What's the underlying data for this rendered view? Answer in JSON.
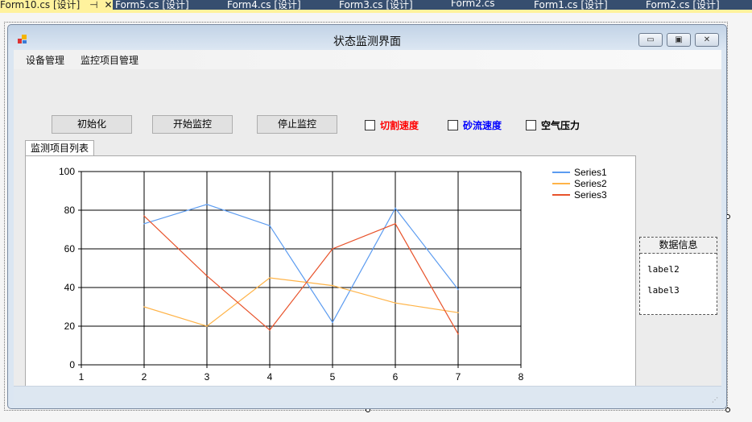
{
  "doc_tabs": [
    {
      "label": "Form10.cs [设计]",
      "active": true
    },
    {
      "label": "Form5.cs [设计]"
    },
    {
      "label": "Form4.cs [设计]"
    },
    {
      "label": "Form3.cs [设计]"
    },
    {
      "label": "Form2.cs"
    },
    {
      "label": "Form1.cs [设计]"
    },
    {
      "label": "Form2.cs [设计]"
    }
  ],
  "window": {
    "title": "状态监测界面"
  },
  "menu": [
    "设备管理",
    "监控项目管理"
  ],
  "buttons": {
    "init": "初始化",
    "start": "开始监控",
    "stop": "停止监控"
  },
  "checkboxes": [
    {
      "label": "切割速度",
      "color": "#ff0000",
      "checked": false
    },
    {
      "label": "砂流速度",
      "color": "#0000ff",
      "checked": false
    },
    {
      "label": "空气压力",
      "color": "#000000",
      "checked": false
    }
  ],
  "panel_tab": "监测项目列表",
  "group": {
    "title": "数据信息",
    "label2": "label2",
    "label3": "label3"
  },
  "chart_data": {
    "type": "line",
    "x": [
      2,
      3,
      4,
      5,
      6,
      7
    ],
    "xlim": [
      1,
      8
    ],
    "ylim": [
      0,
      100
    ],
    "xticks": [
      "1",
      "2",
      "3",
      "4",
      "5",
      "6",
      "7",
      "8"
    ],
    "yticks": [
      "0",
      "20",
      "40",
      "60",
      "80",
      "100"
    ],
    "grid": true,
    "legend": "top-right",
    "series": [
      {
        "name": "Series1",
        "color": "#5b9bf0",
        "values": [
          73,
          83,
          72,
          22,
          81,
          39
        ]
      },
      {
        "name": "Series2",
        "color": "#ffb347",
        "values": [
          30,
          20,
          45,
          41,
          32,
          27
        ]
      },
      {
        "name": "Series3",
        "color": "#e8532b",
        "values": [
          77,
          46,
          18,
          60,
          73,
          16
        ]
      }
    ]
  }
}
